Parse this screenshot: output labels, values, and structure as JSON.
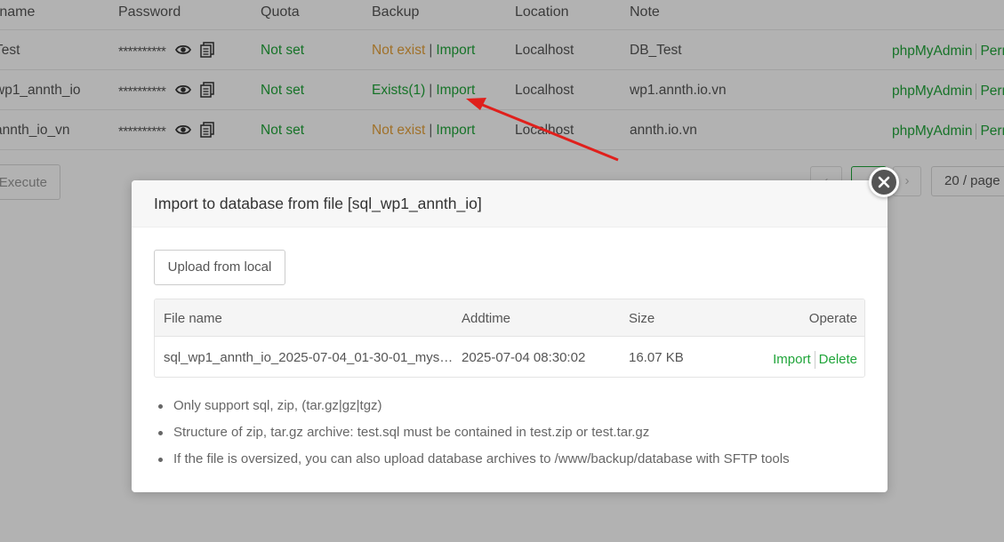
{
  "table": {
    "headers": {
      "name": "rname",
      "password": "Password",
      "quota": "Quota",
      "backup": "Backup",
      "location": "Location",
      "note": "Note"
    },
    "rows": [
      {
        "name": "Test",
        "password": "**********",
        "quota": "Not set",
        "backup_status": "Not exist",
        "backup_import": "Import",
        "location": "Localhost",
        "note": "DB_Test",
        "op_phpmyadmin": "phpMyAdmin",
        "op_perm": "Perm"
      },
      {
        "name": "wp1_annth_io",
        "password": "**********",
        "quota": "Not set",
        "backup_status": "Exists(1)",
        "backup_import": "Import",
        "location": "Localhost",
        "note": "wp1.annth.io.vn",
        "op_phpmyadmin": "phpMyAdmin",
        "op_perm": "Perm"
      },
      {
        "name": "annth_io_vn",
        "password": "**********",
        "quota": "Not set",
        "backup_status": "Not exist",
        "backup_import": "Import",
        "location": "Localhost",
        "note": "annth.io.vn",
        "op_phpmyadmin": "phpMyAdmin",
        "op_perm": "Perm"
      }
    ],
    "separator": "|"
  },
  "footer": {
    "execute_label": "Execute",
    "page_size": "20 / page"
  },
  "modal": {
    "title": "Import to database from file [sql_wp1_annth_io]",
    "upload_label": "Upload from local",
    "file_table": {
      "headers": {
        "file_name": "File name",
        "addtime": "Addtime",
        "size": "Size",
        "operate": "Operate"
      },
      "rows": [
        {
          "file_name": "sql_wp1_annth_io_2025-07-04_01-30-01_mys…",
          "addtime": "2025-07-04 08:30:02",
          "size": "16.07 KB",
          "import_label": "Import",
          "delete_label": "Delete"
        }
      ]
    },
    "notes": [
      "Only support sql, zip, (tar.gz|gz|tgz)",
      "Structure of zip, tar.gz archive: test.sql must be contained in test.zip or test.tar.gz",
      "If the file is oversized, you can also upload database archives to /www/backup/database with SFTP tools"
    ]
  },
  "colors": {
    "accent_green": "#20a53a",
    "warning_orange": "#e6a23c",
    "annotation_red": "#e0201c"
  }
}
